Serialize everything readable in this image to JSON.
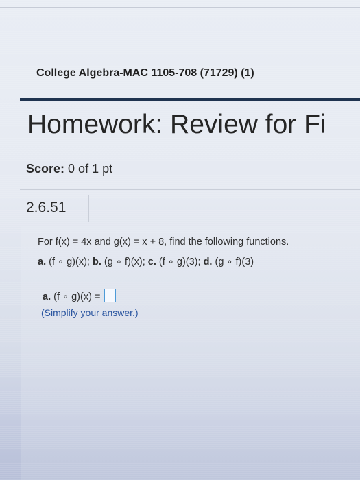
{
  "course": {
    "title": "College Algebra-MAC 1105-708 (71729) (1)"
  },
  "page": {
    "title": "Homework: Review for Fi"
  },
  "score": {
    "label": "Score:",
    "value": "0 of 1 pt"
  },
  "question": {
    "number": "2.6.51",
    "prompt": "For f(x) = 4x and g(x) = x + 8, find the following functions.",
    "parts": [
      {
        "letter": "a.",
        "expr": "(f ∘ g)(x);"
      },
      {
        "letter": "b.",
        "expr": "(g ∘ f)(x);"
      },
      {
        "letter": "c.",
        "expr": "(f ∘ g)(3);"
      },
      {
        "letter": "d.",
        "expr": "(g ∘ f)(3)"
      }
    ],
    "answer": {
      "letter": "a.",
      "expr": "(f ∘ g)(x) =",
      "value": ""
    },
    "hint": "(Simplify your answer.)"
  },
  "colors": {
    "title_bar": "#1f3350",
    "answer_box_border": "#4e9bd8",
    "hint_text": "#2a55a0"
  }
}
